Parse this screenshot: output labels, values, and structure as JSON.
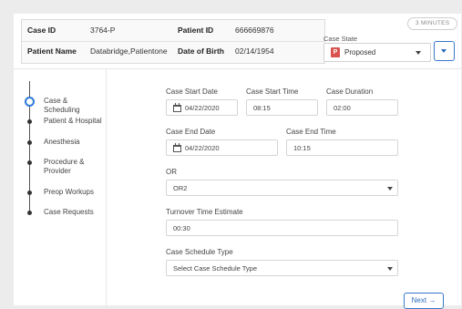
{
  "header": {
    "case_id_label": "Case ID",
    "case_id_value": "3764-P",
    "patient_id_label": "Patient ID",
    "patient_id_value": "666669876",
    "patient_name_label": "Patient Name",
    "patient_name_value": "Databridge,Patientone",
    "dob_label": "Date of Birth",
    "dob_value": "02/14/1954",
    "minutes_badge": "3 MINUTES",
    "case_state_label": "Case State",
    "case_state_badge": "P",
    "case_state_value": "Proposed"
  },
  "steps": [
    {
      "label": "Case & Scheduling",
      "active": true
    },
    {
      "label": "Patient & Hospital",
      "active": false
    },
    {
      "label": "Anesthesia",
      "active": false
    },
    {
      "label": "Procedure &\nProvider",
      "active": false
    },
    {
      "label": "Preop Workups",
      "active": false
    },
    {
      "label": "Case Requests",
      "active": false
    }
  ],
  "form": {
    "start_date_label": "Case Start Date",
    "start_date_value": "04/22/2020",
    "start_time_label": "Case Start Time",
    "start_time_value": "08:15",
    "duration_label": "Case Duration",
    "duration_value": "02:00",
    "end_date_label": "Case End Date",
    "end_date_value": "04/22/2020",
    "end_time_label": "Case End Time",
    "end_time_value": "10:15",
    "or_label": "OR",
    "or_value": "OR2",
    "turnover_label": "Turnover Time Estimate",
    "turnover_value": "00:30",
    "schedule_type_label": "Case Schedule Type",
    "schedule_type_placeholder": "Select Case Schedule Type"
  },
  "footer": {
    "next_label": "Next",
    "next_icon": "arrow-right-icon"
  },
  "colors": {
    "accent": "#2f6cbf",
    "proposed_badge": "#d9534f",
    "background": "#ececec"
  }
}
